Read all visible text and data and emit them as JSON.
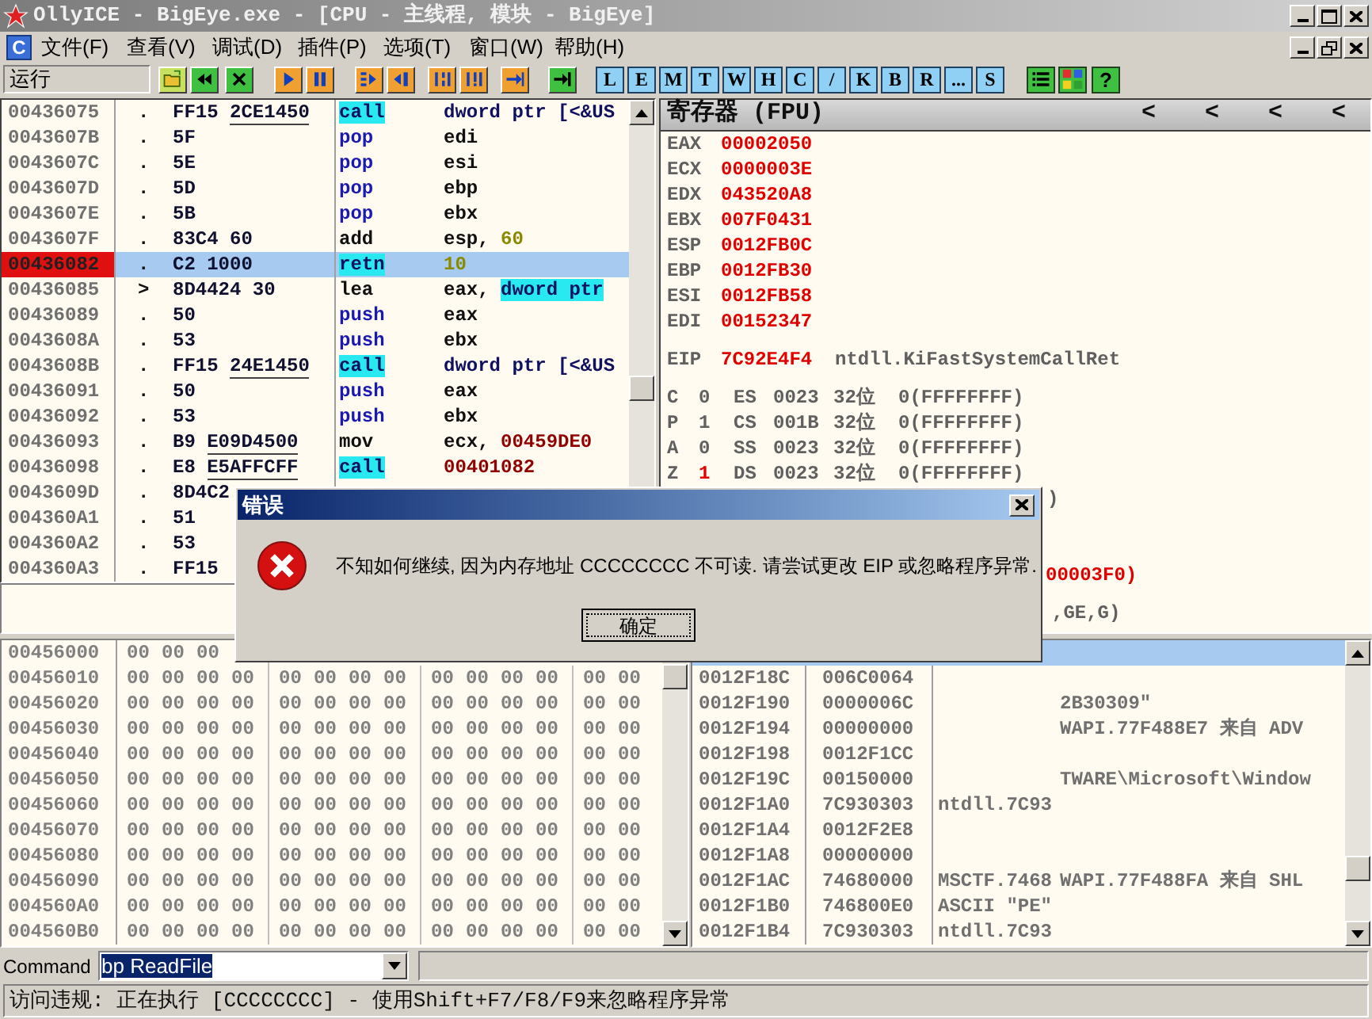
{
  "window": {
    "title": "OllyICE - BigEye.exe - [CPU - 主线程, 模块 - BigEye]"
  },
  "menu_bar": {
    "app_icon_label": "C",
    "items": [
      "文件(F)",
      "查看(V)",
      "调试(D)",
      "插件(P)",
      "选项(T)",
      "窗口(W)",
      "帮助(H)"
    ]
  },
  "toolbar": {
    "state": "运行",
    "letter_buttons": [
      "L",
      "E",
      "M",
      "T",
      "W",
      "H",
      "C",
      "/",
      "K",
      "B",
      "R",
      "...",
      "S"
    ],
    "help_label": "?"
  },
  "disassembly": {
    "rows": [
      {
        "address": "00436075",
        "mark": ".",
        "hex": "FF15",
        "ref": "2CE1450",
        "mnemonic": "call",
        "kind": "highlight",
        "operand": [
          {
            "text": "dword ptr [<&US",
            "kind": "mem"
          }
        ],
        "selected": false,
        "eip": false
      },
      {
        "address": "0043607B",
        "mark": ".",
        "hex": "5F",
        "mnemonic": "pop",
        "kind": "stack",
        "operand": [
          {
            "text": "edi",
            "kind": "plain"
          }
        ],
        "selected": false,
        "eip": false
      },
      {
        "address": "0043607C",
        "mark": ".",
        "hex": "5E",
        "mnemonic": "pop",
        "kind": "stack",
        "operand": [
          {
            "text": "esi",
            "kind": "plain"
          }
        ],
        "selected": false,
        "eip": false
      },
      {
        "address": "0043607D",
        "mark": ".",
        "hex": "5D",
        "mnemonic": "pop",
        "kind": "stack",
        "operand": [
          {
            "text": "ebp",
            "kind": "plain"
          }
        ],
        "selected": false,
        "eip": false
      },
      {
        "address": "0043607E",
        "mark": ".",
        "hex": "5B",
        "mnemonic": "pop",
        "kind": "stack",
        "operand": [
          {
            "text": "ebx",
            "kind": "plain"
          }
        ],
        "selected": false,
        "eip": false
      },
      {
        "address": "0043607F",
        "mark": ".",
        "hex": "83C4 60",
        "mnemonic": "add",
        "kind": "plain",
        "operand": [
          {
            "text": "esp, ",
            "kind": "plain"
          },
          {
            "text": "60",
            "kind": "const"
          }
        ],
        "selected": false,
        "eip": false
      },
      {
        "address": "00436082",
        "mark": ".",
        "hex": "C2 1000",
        "mnemonic": "retn",
        "kind": "highlight",
        "operand": [
          {
            "text": "10",
            "kind": "const"
          }
        ],
        "selected": true,
        "eip": true
      },
      {
        "address": "00436085",
        "mark": ">",
        "hex": "8D4424 30",
        "mnemonic": "lea",
        "kind": "plain",
        "operand": [
          {
            "text": "eax, ",
            "kind": "plain"
          },
          {
            "text": "dword ptr",
            "kind": "memhl"
          }
        ],
        "selected": false,
        "eip": false
      },
      {
        "address": "00436089",
        "mark": ".",
        "hex": "50",
        "mnemonic": "push",
        "kind": "stack",
        "operand": [
          {
            "text": "eax",
            "kind": "plain"
          }
        ],
        "selected": false,
        "eip": false
      },
      {
        "address": "0043608A",
        "mark": ".",
        "hex": "53",
        "mnemonic": "push",
        "kind": "stack",
        "operand": [
          {
            "text": "ebx",
            "kind": "plain"
          }
        ],
        "selected": false,
        "eip": false
      },
      {
        "address": "0043608B",
        "mark": ".",
        "hex": "FF15",
        "ref": "24E1450",
        "mnemonic": "call",
        "kind": "highlight",
        "operand": [
          {
            "text": "dword ptr [<&US",
            "kind": "mem"
          }
        ],
        "selected": false,
        "eip": false
      },
      {
        "address": "00436091",
        "mark": ".",
        "hex": "50",
        "mnemonic": "push",
        "kind": "stack",
        "operand": [
          {
            "text": "eax",
            "kind": "plain"
          }
        ],
        "selected": false,
        "eip": false
      },
      {
        "address": "00436092",
        "mark": ".",
        "hex": "53",
        "mnemonic": "push",
        "kind": "stack",
        "operand": [
          {
            "text": "ebx",
            "kind": "plain"
          }
        ],
        "selected": false,
        "eip": false
      },
      {
        "address": "00436093",
        "mark": ".",
        "hex": "B9",
        "ref": "E09D4500",
        "mnemonic": "mov",
        "kind": "plain",
        "operand": [
          {
            "text": "ecx, ",
            "kind": "plain"
          },
          {
            "text": "00459DE0",
            "kind": "addr"
          }
        ],
        "selected": false,
        "eip": false
      },
      {
        "address": "00436098",
        "mark": ".",
        "hex": "E8",
        "ref": "E5AFFCFF",
        "mnemonic": "call",
        "kind": "highlight",
        "operand": [
          {
            "text": "00401082",
            "kind": "addr"
          }
        ],
        "selected": false,
        "eip": false
      },
      {
        "address": "0043609D",
        "mark": ".",
        "hex": "8D4C2",
        "selected": false,
        "eip": false
      },
      {
        "address": "004360A1",
        "mark": ".",
        "hex": "51",
        "selected": false,
        "eip": false
      },
      {
        "address": "004360A2",
        "mark": ".",
        "hex": "53",
        "selected": false,
        "eip": false
      },
      {
        "address": "004360A3",
        "mark": ".",
        "hex": "FF15",
        "selected": false,
        "eip": false
      }
    ]
  },
  "registers": {
    "title": "寄存器 (FPU)",
    "nav_buttons": [
      "<",
      "<",
      "<",
      "<"
    ],
    "general": [
      {
        "name": "EAX",
        "value": "00002050",
        "changed": true
      },
      {
        "name": "ECX",
        "value": "0000003E",
        "changed": true
      },
      {
        "name": "EDX",
        "value": "043520A8",
        "changed": true
      },
      {
        "name": "EBX",
        "value": "007F0431",
        "changed": true
      },
      {
        "name": "ESP",
        "value": "0012FB0C",
        "changed": true
      },
      {
        "name": "EBP",
        "value": "0012FB30",
        "changed": true
      },
      {
        "name": "ESI",
        "value": "0012FB58",
        "changed": true
      },
      {
        "name": "EDI",
        "value": "00152347",
        "changed": true
      }
    ],
    "eip": {
      "name": "EIP",
      "value": "7C92E4F4",
      "comment": "ntdll.KiFastSystemCallRet",
      "changed": true
    },
    "flags": [
      {
        "flag": "C",
        "value": "0",
        "changed": false,
        "segment": "ES",
        "selector": "0023",
        "bits": "32位",
        "limit": "0(FFFFFFFF)"
      },
      {
        "flag": "P",
        "value": "1",
        "changed": false,
        "segment": "CS",
        "selector": "001B",
        "bits": "32位",
        "limit": "0(FFFFFFFF)"
      },
      {
        "flag": "A",
        "value": "0",
        "changed": false,
        "segment": "SS",
        "selector": "0023",
        "bits": "32位",
        "limit": "0(FFFFFFFF)"
      },
      {
        "flag": "Z",
        "value": "1",
        "changed": true,
        "segment": "DS",
        "selector": "0023",
        "bits": "32位",
        "limit": "0(FFFFFFFF)"
      }
    ],
    "partly_hidden": [
      {
        "text": ")",
        "changed": false
      },
      {
        "text": "00003F0)",
        "changed": true
      },
      {
        "text": ",GE,G)",
        "changed": false
      }
    ]
  },
  "dump": {
    "rows": [
      {
        "address": "00456000",
        "bytes": [
          "00",
          "00",
          "00"
        ]
      },
      {
        "address": "00456010",
        "bytes": [
          "00",
          "00",
          "00",
          "00",
          "00",
          "00",
          "00",
          "00",
          "00",
          "00",
          "00",
          "00",
          "00",
          "00"
        ]
      },
      {
        "address": "00456020",
        "bytes": [
          "00",
          "00",
          "00",
          "00",
          "00",
          "00",
          "00",
          "00",
          "00",
          "00",
          "00",
          "00",
          "00",
          "00"
        ]
      },
      {
        "address": "00456030",
        "bytes": [
          "00",
          "00",
          "00",
          "00",
          "00",
          "00",
          "00",
          "00",
          "00",
          "00",
          "00",
          "00",
          "00",
          "00"
        ]
      },
      {
        "address": "00456040",
        "bytes": [
          "00",
          "00",
          "00",
          "00",
          "00",
          "00",
          "00",
          "00",
          "00",
          "00",
          "00",
          "00",
          "00",
          "00"
        ]
      },
      {
        "address": "00456050",
        "bytes": [
          "00",
          "00",
          "00",
          "00",
          "00",
          "00",
          "00",
          "00",
          "00",
          "00",
          "00",
          "00",
          "00",
          "00"
        ]
      },
      {
        "address": "00456060",
        "bytes": [
          "00",
          "00",
          "00",
          "00",
          "00",
          "00",
          "00",
          "00",
          "00",
          "00",
          "00",
          "00",
          "00",
          "00"
        ]
      },
      {
        "address": "00456070",
        "bytes": [
          "00",
          "00",
          "00",
          "00",
          "00",
          "00",
          "00",
          "00",
          "00",
          "00",
          "00",
          "00",
          "00",
          "00"
        ]
      },
      {
        "address": "00456080",
        "bytes": [
          "00",
          "00",
          "00",
          "00",
          "00",
          "00",
          "00",
          "00",
          "00",
          "00",
          "00",
          "00",
          "00",
          "00"
        ]
      },
      {
        "address": "00456090",
        "bytes": [
          "00",
          "00",
          "00",
          "00",
          "00",
          "00",
          "00",
          "00",
          "00",
          "00",
          "00",
          "00",
          "00",
          "00"
        ]
      },
      {
        "address": "004560A0",
        "bytes": [
          "00",
          "00",
          "00",
          "00",
          "00",
          "00",
          "00",
          "00",
          "00",
          "00",
          "00",
          "00",
          "00",
          "00"
        ]
      },
      {
        "address": "004560B0",
        "bytes": [
          "00",
          "00",
          "00",
          "00",
          "00",
          "00",
          "00",
          "00",
          "00",
          "00",
          "00",
          "00",
          "00",
          "00"
        ]
      }
    ]
  },
  "stack": {
    "rows": [
      {
        "address": "0012F18C",
        "value": "006C0064"
      },
      {
        "address": "0012F190",
        "value": "0000006C",
        "column_4": "2B30309\""
      },
      {
        "address": "0012F194",
        "value": "00000000",
        "column_4": "WAPI.77F488E7 来自 ADV"
      },
      {
        "address": "0012F198",
        "value": "0012F1CC"
      },
      {
        "address": "0012F19C",
        "value": "00150000",
        "column_4": "TWARE\\Microsoft\\Window"
      },
      {
        "address": "0012F1A0",
        "value": "7C930303",
        "comment": "ntdll.7C93"
      },
      {
        "address": "0012F1A4",
        "value": "0012F2E8"
      },
      {
        "address": "0012F1A8",
        "value": "00000000"
      },
      {
        "address": "0012F1AC",
        "value": "74680000",
        "comment": "MSCTF.7468",
        "column_4": "WAPI.77F488FA 来自 SHL"
      },
      {
        "address": "0012F1B0",
        "value": "746800E0",
        "comment": "ASCII \"PE\""
      },
      {
        "address": "0012F1B4",
        "value": "7C930303",
        "comment": "ntdll.7C93"
      }
    ]
  },
  "command_bar": {
    "label": "Command",
    "value": "bp ReadFile"
  },
  "status_bar": {
    "text": "访问违规: 正在执行 [CCCCCCCC] - 使用Shift+F7/F8/F9来忽略程序异常"
  },
  "dialog": {
    "title": "错误",
    "message": "不知如何继续, 因为内存地址 CCCCCCCC 不可读. 请尝试更改 EIP 或忽略程序异常.",
    "button": "确定"
  }
}
